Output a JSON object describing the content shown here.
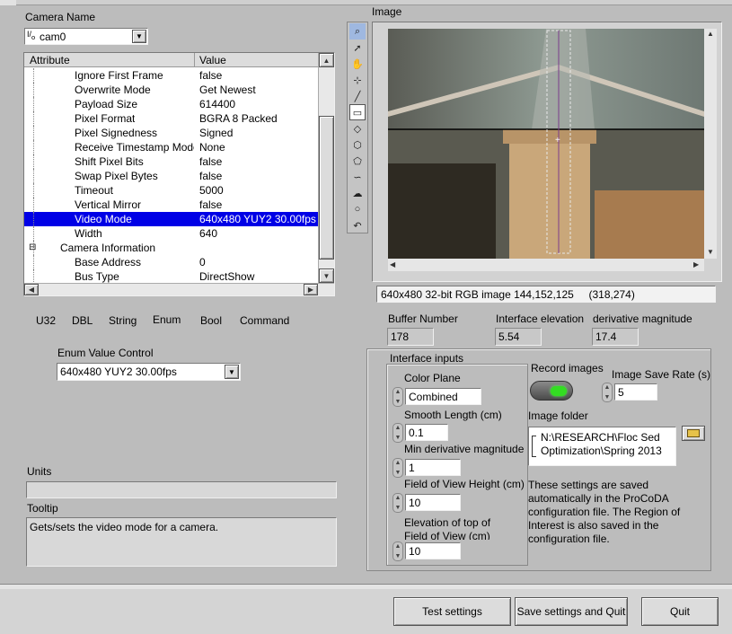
{
  "camera": {
    "label": "Camera Name",
    "selected": "cam0",
    "io_glyph": "I/O"
  },
  "attr_table": {
    "headers": [
      "Attribute",
      "Value"
    ],
    "rows": [
      {
        "name": "Ignore First Frame",
        "value": "false",
        "indent": 2
      },
      {
        "name": "Overwrite Mode",
        "value": "Get Newest",
        "indent": 2
      },
      {
        "name": "Payload Size",
        "value": "614400",
        "indent": 2
      },
      {
        "name": "Pixel Format",
        "value": "BGRA 8 Packed",
        "indent": 2
      },
      {
        "name": "Pixel Signedness",
        "value": "Signed",
        "indent": 2
      },
      {
        "name": "Receive Timestamp Mode",
        "value": "None",
        "indent": 2
      },
      {
        "name": "Shift Pixel Bits",
        "value": "false",
        "indent": 2
      },
      {
        "name": "Swap Pixel Bytes",
        "value": "false",
        "indent": 2
      },
      {
        "name": "Timeout",
        "value": "5000",
        "indent": 2
      },
      {
        "name": "Vertical Mirror",
        "value": "false",
        "indent": 2
      },
      {
        "name": "Video Mode",
        "value": "640x480 YUY2 30.00fps",
        "indent": 2,
        "selected": true
      },
      {
        "name": "Width",
        "value": "640",
        "indent": 2
      },
      {
        "name": "Camera Information",
        "value": "",
        "indent": 1,
        "expander": "⊟"
      },
      {
        "name": "Base Address",
        "value": "0",
        "indent": 2
      },
      {
        "name": "Bus Type",
        "value": "DirectShow",
        "indent": 2
      }
    ]
  },
  "type_tabs": [
    "U32",
    "DBL",
    "String",
    "Enum",
    "Bool",
    "Command"
  ],
  "enum_control": {
    "label": "Enum Value Control",
    "value": "640x480 YUY2 30.00fps"
  },
  "units": {
    "label": "Units",
    "value": ""
  },
  "tooltip": {
    "label": "Tooltip",
    "value": "Gets/sets the video mode for a camera."
  },
  "image": {
    "label": "Image",
    "status": "640x480 32-bit RGB image 144,152,125     (318,274)"
  },
  "indicators": [
    {
      "label": "Buffer Number",
      "value": "178"
    },
    {
      "label": "Interface elevation",
      "value": "5.54"
    },
    {
      "label": "derivative magnitude",
      "value": "17.4"
    }
  ],
  "interface_inputs": {
    "title": "Interface inputs",
    "color_plane": {
      "label": "Color Plane",
      "value": "Combined"
    },
    "smooth_length": {
      "label": "Smooth Length (cm)",
      "value": "0.1"
    },
    "min_derivative": {
      "label": "Min derivative magnitude",
      "value": "1"
    },
    "fov_height": {
      "label": "Field of View Height (cm)",
      "value": "10"
    },
    "elevation_top_line1": "Elevation of top of",
    "elevation_top_line2": "Field of View (cm)",
    "elevation_top_value": "10"
  },
  "record": {
    "label": "Record images",
    "led_color": "#33dd22"
  },
  "save_rate": {
    "label": "Image Save Rate (s)",
    "value": "5"
  },
  "image_folder": {
    "label": "Image folder",
    "line1": "N:\\RESEARCH\\Floc Sed",
    "line2": "Optimization\\Spring 2013"
  },
  "settings_note": "These settings are saved automatically in the  ProCoDA configuration file. The Region of Interest is also saved in the configuration file.",
  "buttons": {
    "test": "Test settings",
    "save_quit": "Save settings and Quit",
    "quit": "Quit"
  },
  "tool_icons": [
    "zoom-icon",
    "pointer-icon",
    "pan-icon",
    "crosshair-icon",
    "line-icon",
    "rectangle-icon",
    "rotated-rect-icon",
    "annulus-icon",
    "polygon-icon",
    "freehand-icon",
    "freehand-region-icon",
    "oval-icon",
    "broken-line-icon"
  ]
}
